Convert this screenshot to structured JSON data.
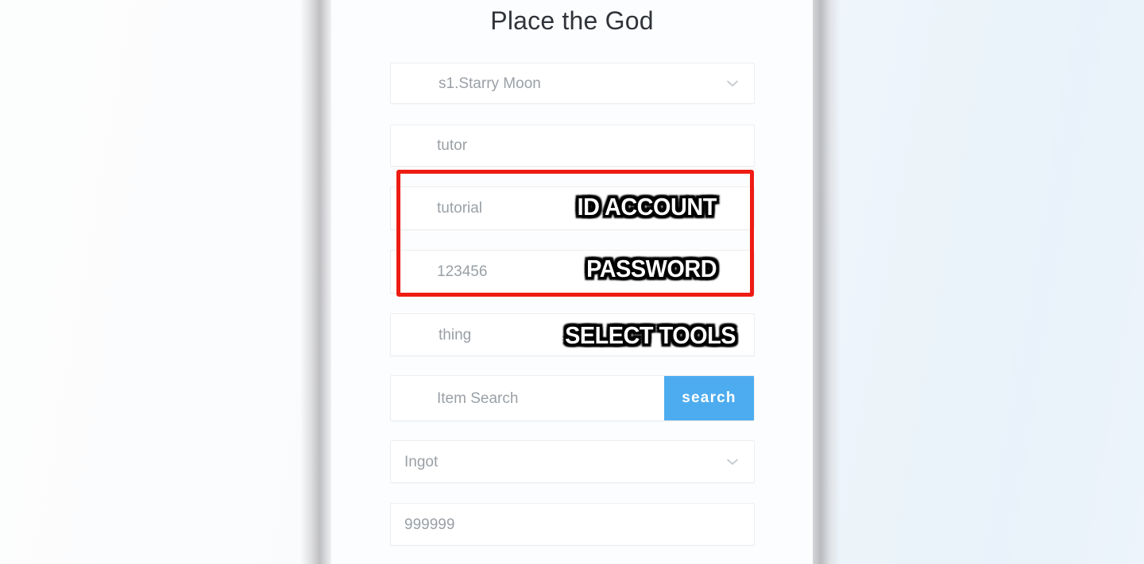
{
  "page": {
    "title": "Place the God"
  },
  "form": {
    "server_select": {
      "value": "s1.Starry Moon",
      "icon": "chevron-down-icon"
    },
    "account_field": {
      "value": "tutor"
    },
    "username_field": {
      "value": "tutorial"
    },
    "password_field": {
      "value": "123456"
    },
    "tool_select": {
      "value": "thing",
      "icon": "chevron-down-icon"
    },
    "item_search": {
      "value": "Item Search",
      "button_label": "search"
    },
    "item_select": {
      "value": "Ingot",
      "icon": "chevron-down-icon"
    },
    "amount_field": {
      "value": "999999"
    }
  },
  "annotations": {
    "id_account": "ID ACCOUNT",
    "password": "PASSWORD",
    "select_tools": "SELECT TOOLS"
  },
  "colors": {
    "search_button": "#4dacef",
    "highlight_box": "#ee1c12",
    "field_text": "#9aa0a6",
    "title_text": "#30343a",
    "panel_background": "#fcfdfe"
  }
}
